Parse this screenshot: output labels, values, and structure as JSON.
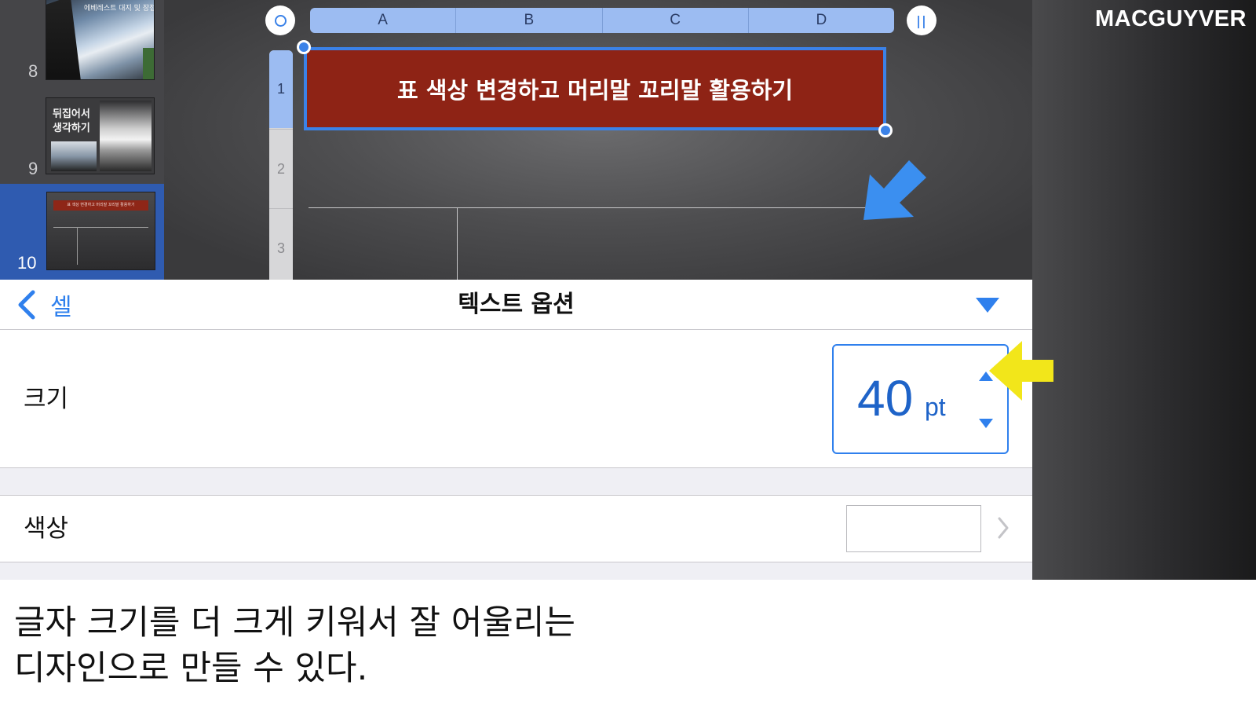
{
  "navigator": {
    "slides": [
      {
        "number": "8",
        "thumb_title": "에베레스트 대지 및 장접하기"
      },
      {
        "number": "9",
        "thumb_title": "뒤집어서\n생각하기"
      },
      {
        "number": "10",
        "thumb_title": "표 색상 변경하고 머리말 꼬리말 활용하기",
        "selected": true
      }
    ]
  },
  "table": {
    "columns": [
      "A",
      "B",
      "C",
      "D"
    ],
    "rows": [
      "1",
      "2",
      "3"
    ],
    "selected_cell_text": "표 색상 변경하고 머리말 꼬리말 활용하기",
    "cell_fill_color": "#8e2315",
    "selection_color": "#3b82e8"
  },
  "brand": {
    "watermark": "MACGUYVER"
  },
  "inspector": {
    "back_label": "셀",
    "title": "텍스트 옵션",
    "size": {
      "label": "크기",
      "value": "40",
      "unit": "pt"
    },
    "color": {
      "label": "색상",
      "swatch": "#ffffff"
    }
  },
  "caption": {
    "text": "글자 크기를 더 크게 키워서 잘 어울리는\n디자인으로 만들 수 있다."
  },
  "icons": {
    "back": "chevron-left-icon",
    "collapse": "triangle-down-icon",
    "increment": "triangle-up-icon",
    "decrement": "triangle-down-icon",
    "disclosure": "chevron-right-icon",
    "annotation_blue": "arrow-down-left-icon",
    "annotation_yellow": "arrow-left-icon"
  },
  "colors": {
    "accent": "#2f80ed",
    "annotation_blue": "#3b8ff0",
    "annotation_yellow": "#f2e61a"
  }
}
